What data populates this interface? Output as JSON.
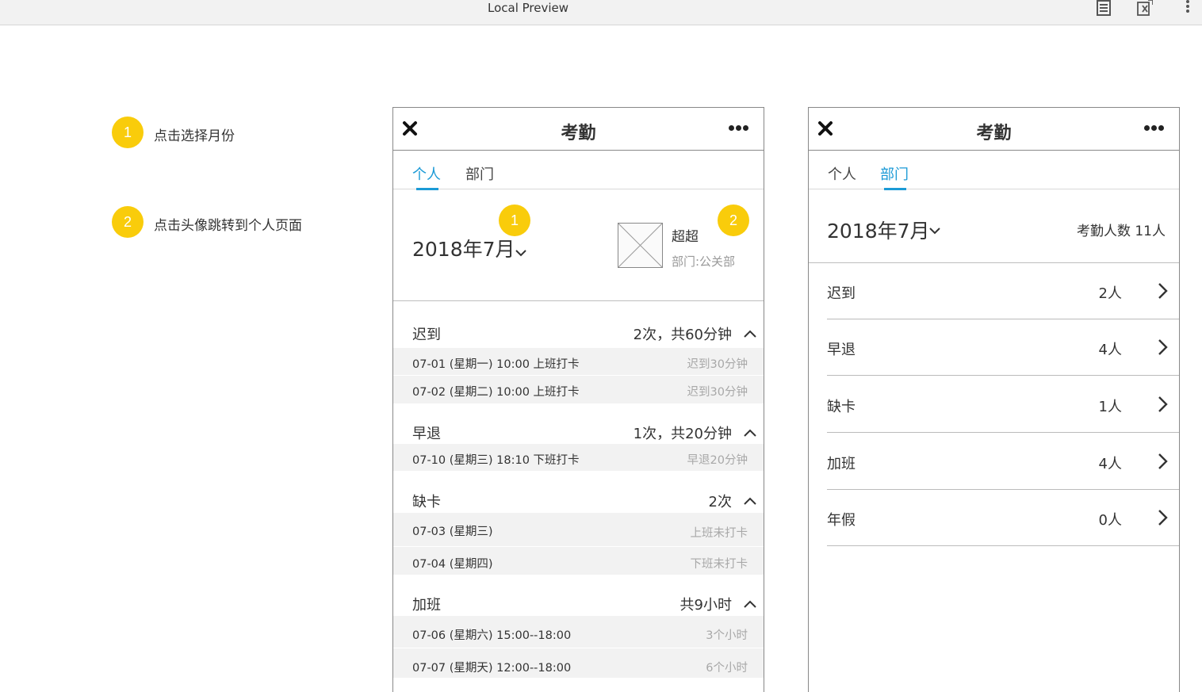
{
  "browser": {
    "title": "Local Preview",
    "icons": [
      "document-icon",
      "export-icon",
      "more-vertical-icon"
    ]
  },
  "notes": [
    {
      "num": "1",
      "text": "点击选择月份"
    },
    {
      "num": "2",
      "text": "点击头像跳转到个人页面"
    }
  ],
  "colors": {
    "accent": "#1b9ad6",
    "badge": "#f9cc0b",
    "row_bg": "#f2f2f2"
  },
  "left_phone": {
    "title": "考勤",
    "tabs": [
      {
        "label": "个人",
        "active": true
      },
      {
        "label": "部门",
        "active": false
      }
    ],
    "month": "2018年7月",
    "user": {
      "name": "超超",
      "dept": "部门:公关部"
    },
    "badges": [
      "1",
      "2"
    ],
    "sections": [
      {
        "title": "迟到",
        "summary": "2次，共60分钟",
        "rows": [
          {
            "left": "07-01 (星期一) 10:00 上班打卡",
            "right": "迟到30分钟"
          },
          {
            "left": "07-02 (星期二) 10:00 上班打卡",
            "right": "迟到30分钟"
          }
        ]
      },
      {
        "title": "早退",
        "summary": "1次，共20分钟",
        "rows": [
          {
            "left": "07-10 (星期三) 18:10 下班打卡",
            "right": "早退20分钟"
          }
        ]
      },
      {
        "title": "缺卡",
        "summary": "2次",
        "rows": [
          {
            "left": "07-03 (星期三)",
            "right": "上班未打卡"
          },
          {
            "left": "07-04 (星期四)",
            "right": "下班未打卡"
          }
        ]
      },
      {
        "title": "加班",
        "summary": "共9小时",
        "rows": [
          {
            "left": "07-06 (星期六) 15:00--18:00",
            "right": "3个小时"
          },
          {
            "left": "07-07 (星期天) 12:00--18:00",
            "right": "6个小时"
          }
        ]
      }
    ]
  },
  "right_phone": {
    "title": "考勤",
    "tabs": [
      {
        "label": "个人",
        "active": false
      },
      {
        "label": "部门",
        "active": true
      }
    ],
    "month": "2018年7月",
    "count": "考勤人数 11人",
    "items": [
      {
        "label": "迟到",
        "value": "2人"
      },
      {
        "label": "早退",
        "value": "4人"
      },
      {
        "label": "缺卡",
        "value": "1人"
      },
      {
        "label": "加班",
        "value": "4人"
      },
      {
        "label": "年假",
        "value": "0人"
      }
    ]
  }
}
